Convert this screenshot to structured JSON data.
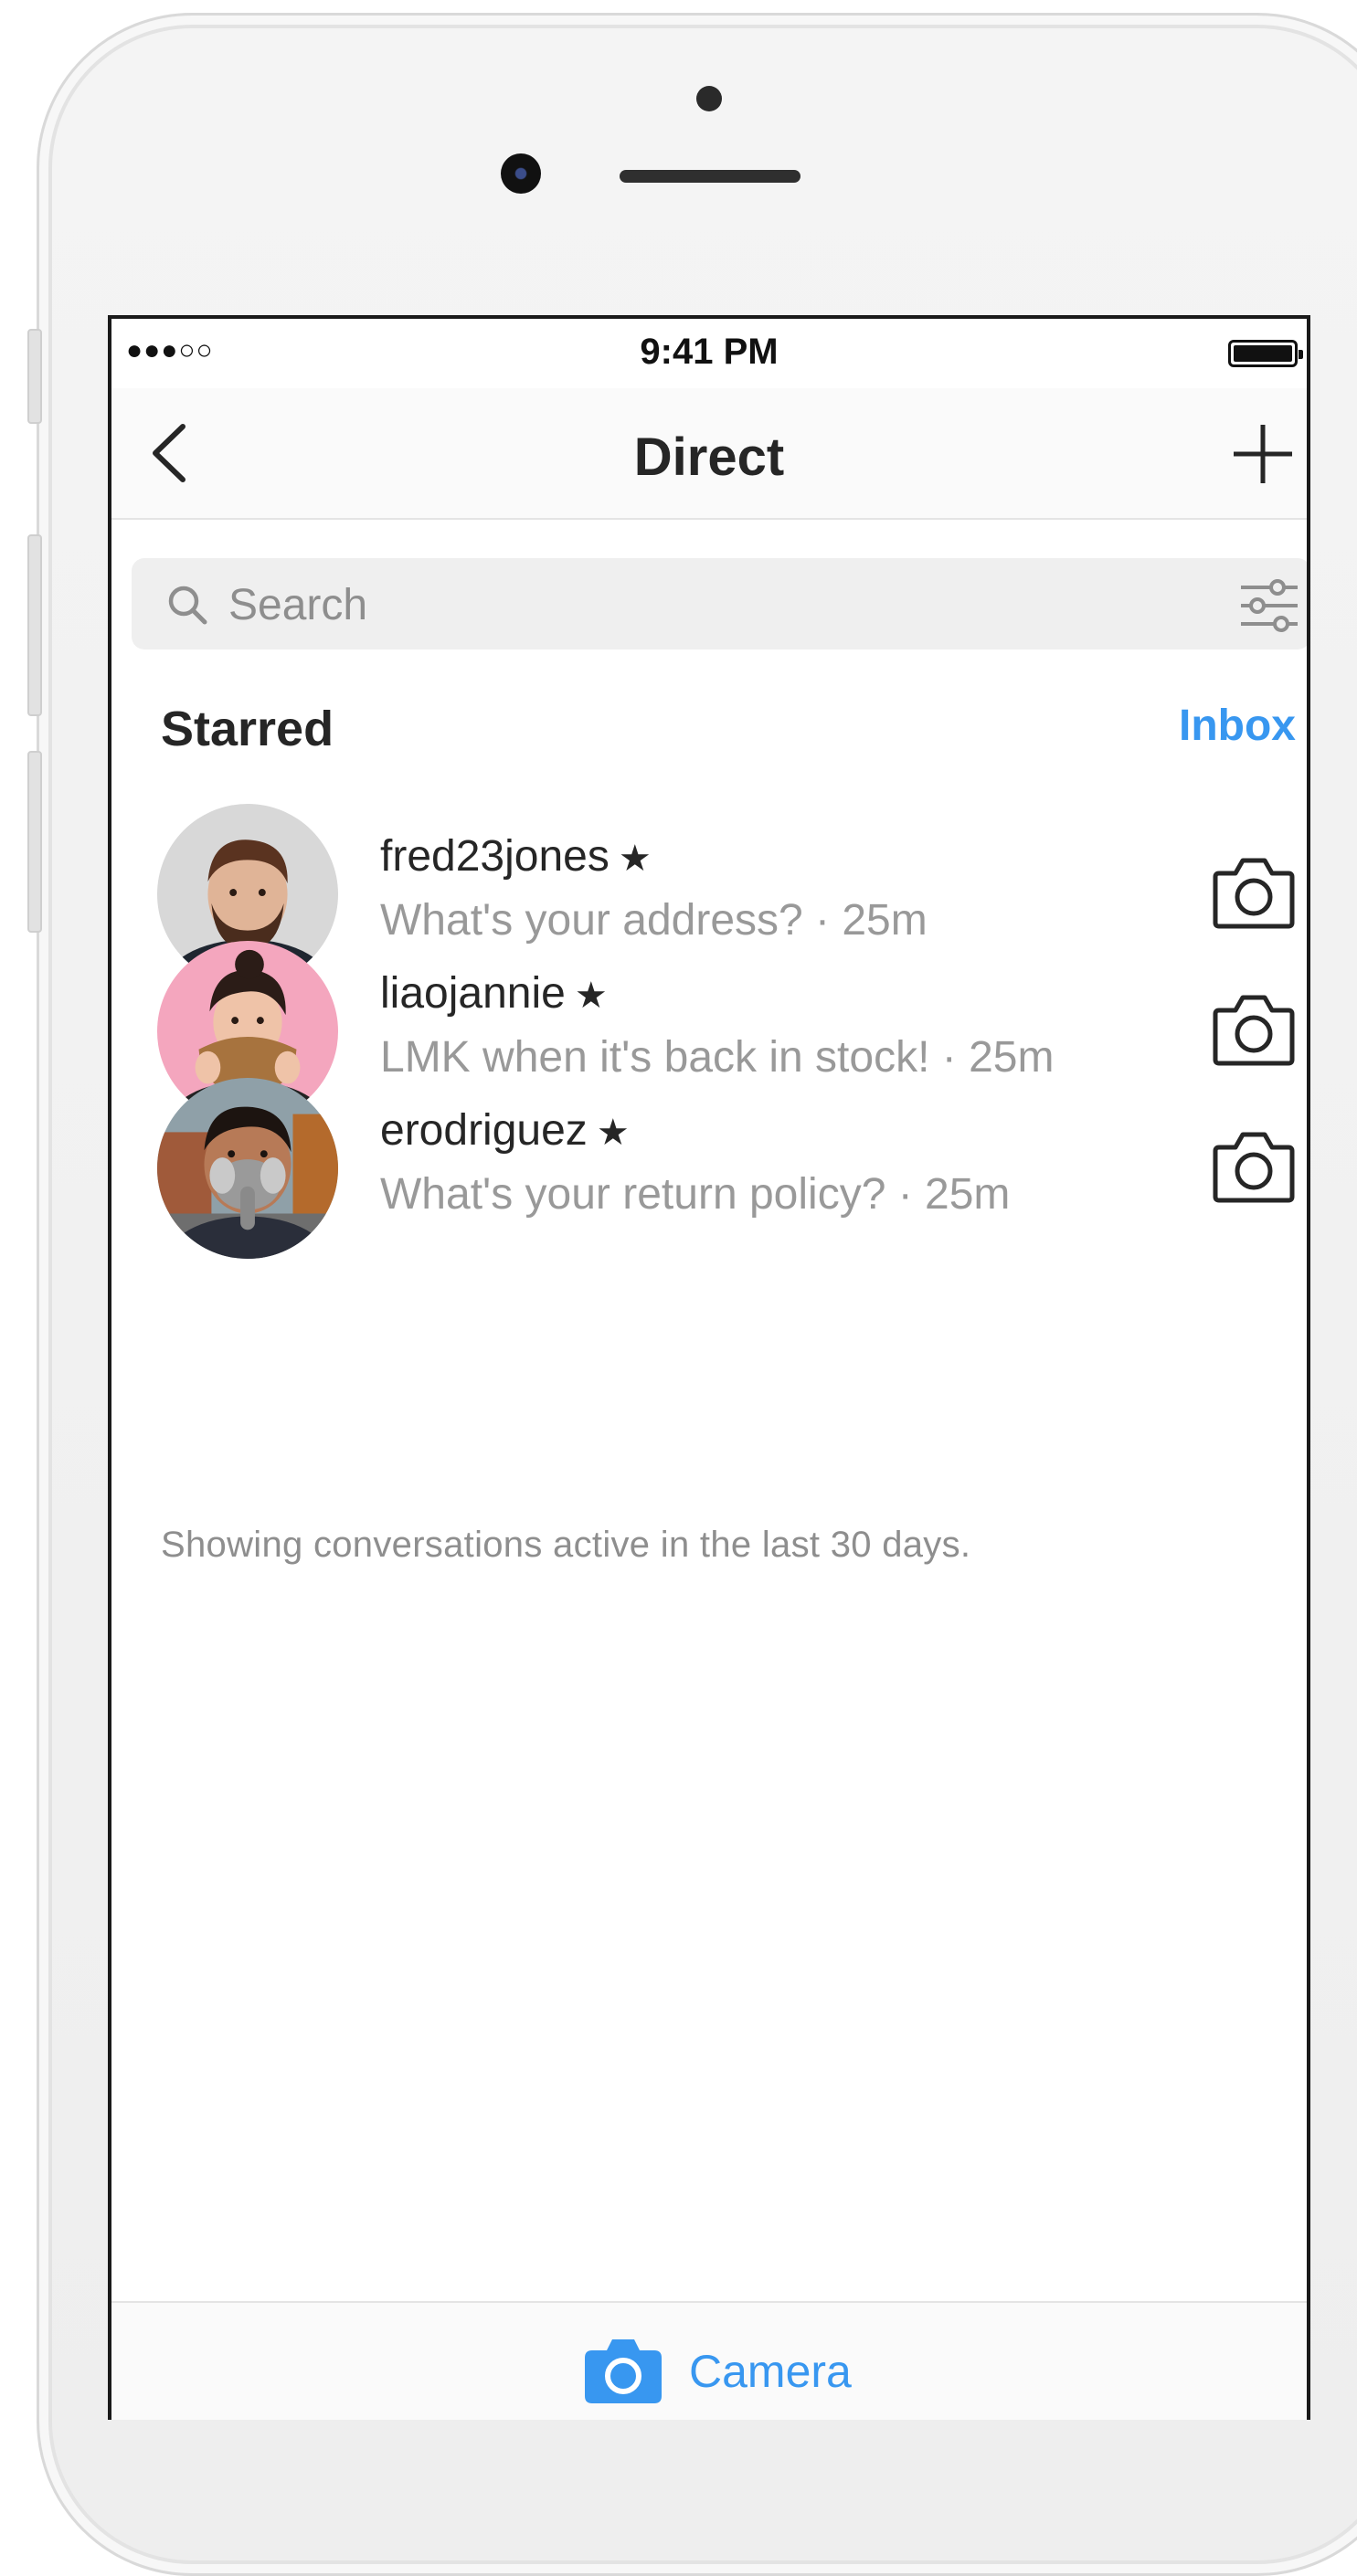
{
  "status_bar": {
    "signal": "●●●○○",
    "time": "9:41 PM"
  },
  "nav": {
    "title": "Direct"
  },
  "search": {
    "placeholder": "Search"
  },
  "section": {
    "title": "Starred",
    "inbox_label": "Inbox"
  },
  "threads": [
    {
      "username": "fred23jones",
      "star": "★",
      "message": "What's your address? · 25m"
    },
    {
      "username": "liaojannie",
      "star": "★",
      "message": "LMK when it's back in stock! · 25m"
    },
    {
      "username": "erodriguez",
      "star": "★",
      "message": "What's your return policy? · 25m"
    }
  ],
  "footer_note": "Showing conversations active in the last 30 days.",
  "bottom_bar": {
    "label": "Camera"
  },
  "colors": {
    "accent": "#3897f0",
    "text": "#262626",
    "secondary_text": "#999999"
  },
  "icons": [
    "back-chevron-icon",
    "plus-icon",
    "search-icon",
    "filter-sliders-icon",
    "camera-icon",
    "star-icon"
  ]
}
